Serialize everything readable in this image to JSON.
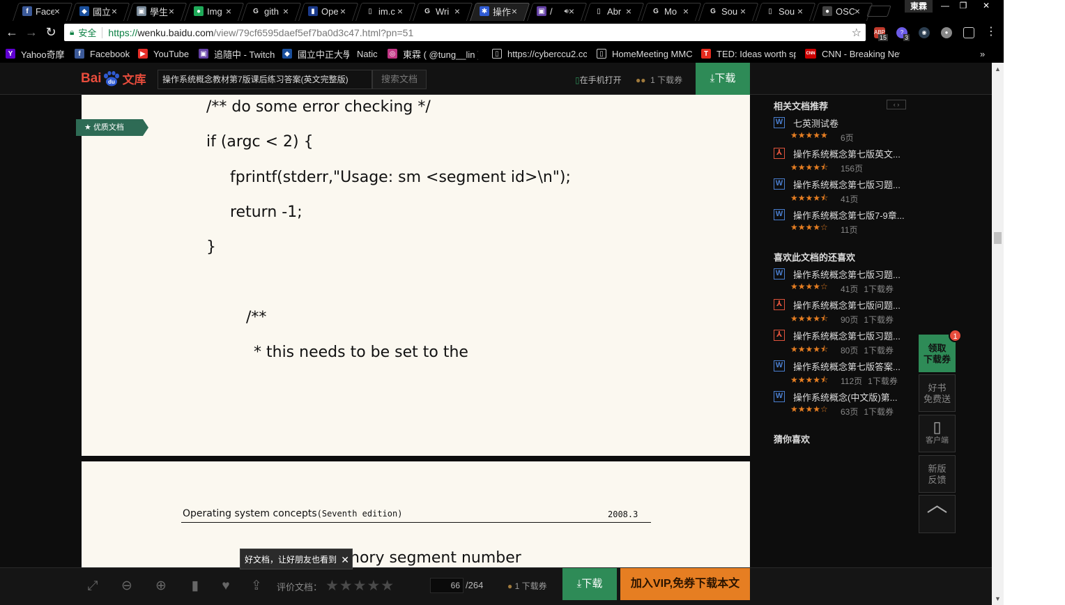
{
  "colors": {
    "accent_green": "#2e8b57",
    "vip_orange": "#e67e22",
    "star_orange": "#e67e22",
    "page_bg": "#fbf8f0",
    "badge_red": "#e74c3c"
  },
  "tabs": [
    {
      "title": "Face",
      "icon": "facebook-icon",
      "color": "#3b5998",
      "glyph": "f"
    },
    {
      "title": "國立",
      "icon": "school-icon",
      "color": "#1a4f9c",
      "glyph": "◆"
    },
    {
      "title": "學生",
      "icon": "image-icon",
      "color": "#7a8a99",
      "glyph": "▣"
    },
    {
      "title": "Img",
      "icon": "green-dot-icon",
      "color": "#1faa59",
      "glyph": "●"
    },
    {
      "title": "gith",
      "icon": "google-icon",
      "color": "#ffffff",
      "glyph": "G"
    },
    {
      "title": "Ope",
      "icon": "bookmark-icon",
      "color": "#1b3a8a",
      "glyph": "▮"
    },
    {
      "title": "im.c",
      "icon": "page-icon",
      "color": "#ffffff",
      "glyph": "▯"
    },
    {
      "title": "Wri",
      "icon": "google-icon",
      "color": "#ffffff",
      "glyph": "G"
    },
    {
      "title": "操作",
      "icon": "baidu-icon",
      "color": "#2f5bd3",
      "glyph": "✱",
      "active": true
    },
    {
      "title": "/",
      "icon": "twitch-icon",
      "color": "#6441a4",
      "glyph": "▣",
      "audio": true
    },
    {
      "title": "Abr",
      "icon": "page-icon",
      "color": "#ffffff",
      "glyph": "▯"
    },
    {
      "title": "Mo",
      "icon": "google-icon",
      "color": "#ffffff",
      "glyph": "G"
    },
    {
      "title": "Sou",
      "icon": "google-icon",
      "color": "#ffffff",
      "glyph": "G"
    },
    {
      "title": "Sou",
      "icon": "page-icon",
      "color": "#ffffff",
      "glyph": "▯"
    },
    {
      "title": "OSC",
      "icon": "github-icon",
      "color": "#444444",
      "glyph": "●"
    }
  ],
  "window": {
    "profile": "東霖",
    "minimize": "—",
    "restore": "❐",
    "close": "✕"
  },
  "toolbar": {
    "secure_label": "安全",
    "url_proto": "https://",
    "url_host": "wenku.baidu.com",
    "url_path": "/view/79cf6595daef5ef7ba0d3c47.html?pn=51",
    "ext_badges": [
      "15",
      "3"
    ]
  },
  "bookmarks": [
    {
      "label": "Yahoo奇摩",
      "icon": "yahoo-icon",
      "color": "#5f01d1",
      "glyph": "Y"
    },
    {
      "label": "Facebook",
      "icon": "facebook-icon",
      "color": "#3b5998",
      "glyph": "f"
    },
    {
      "label": "YouTube",
      "icon": "youtube-icon",
      "color": "#e52d27",
      "glyph": "▶"
    },
    {
      "label": "追隨中 - Twitch",
      "icon": "twitch-icon",
      "color": "#6441a4",
      "glyph": "▣"
    },
    {
      "label": "國立中正大學",
      "icon": "school-icon",
      "color": "#1a4f9c",
      "glyph": "◆"
    },
    {
      "label": "Natic",
      "icon": "blank-icon",
      "color": "#000000",
      "glyph": ""
    },
    {
      "label": "東霖 ( @tung__lin )",
      "icon": "instagram-icon",
      "color": "#c13584",
      "glyph": "◎"
    },
    {
      "label": "https://cyberccu2.cc",
      "icon": "page-icon",
      "color": "#000000",
      "glyph": "▯"
    },
    {
      "label": "HomeMeeting MMC",
      "icon": "page-icon",
      "color": "#000000",
      "glyph": "▯"
    },
    {
      "label": "TED: Ideas worth sp",
      "icon": "ted-icon",
      "color": "#e62b1e",
      "glyph": "T"
    },
    {
      "label": "CNN - Breaking New",
      "icon": "cnn-icon",
      "color": "#cc0000",
      "glyph": "CNN"
    }
  ],
  "bookmarks_overflow": "»",
  "baidu": {
    "logo_bai": "Bai",
    "logo_du": "du",
    "logo_wenku": "文库",
    "search_value": "操作系统概念教材第7版课后练习答案(英文完整版)",
    "search_button": "搜索文档",
    "open_on_phone": "在手机打开",
    "coupon_count": "1 下载券",
    "download": "下载"
  },
  "document": {
    "quality_badge": "优质文档",
    "page1_lines": [
      "/** do some error checking */",
      "if (argc < 2) {",
      "fprintf(stderr,\"Usage: sm <segment id>\\n\");",
      "return -1;",
      "}",
      "/**",
      "* this needs to be set to the"
    ],
    "page2_header_title": "Operating system concepts",
    "page2_header_edition": "(Seventh  edition)",
    "page2_header_date": "2008.3",
    "page2_line": "nory segment number",
    "share_tooltip": "好文档，让好朋友也看到",
    "tooltip_close": "✕"
  },
  "sidebar": {
    "related_title": "相关文档推荐",
    "related": [
      {
        "name": "七英测试卷",
        "type": "word",
        "stars": "★★★★★",
        "pages": "6页",
        "coupons": ""
      },
      {
        "name": "操作系统概念第七版英文...",
        "type": "pdf",
        "stars": "★★★★⯪",
        "pages": "156页",
        "coupons": ""
      },
      {
        "name": "操作系统概念第七版习题...",
        "type": "word",
        "stars": "★★★★⯪",
        "pages": "41页",
        "coupons": ""
      },
      {
        "name": "操作系统概念第七版7-9章...",
        "type": "word",
        "stars": "★★★★☆",
        "pages": "11页",
        "coupons": ""
      }
    ],
    "liked_title": "喜欢此文档的还喜欢",
    "liked": [
      {
        "name": "操作系统概念第七版习题...",
        "type": "word",
        "stars": "★★★★☆",
        "pages": "41页",
        "coupons": "1下载券"
      },
      {
        "name": "操作系统概念第七版问题...",
        "type": "pdf",
        "stars": "★★★★⯪",
        "pages": "90页",
        "coupons": "1下载券"
      },
      {
        "name": "操作系统概念第七版习题...",
        "type": "pdf",
        "stars": "★★★★⯪",
        "pages": "80页",
        "coupons": "1下载券"
      },
      {
        "name": "操作系统概念第七版答案...",
        "type": "word",
        "stars": "★★★★⯪",
        "pages": "112页",
        "coupons": "1下载券"
      },
      {
        "name": "操作系统概念(中文版)第...",
        "type": "word",
        "stars": "★★★★☆",
        "pages": "63页",
        "coupons": "1下载券"
      }
    ],
    "guess_title": "猜你喜欢"
  },
  "float_buttons": {
    "coupon_line1": "领取",
    "coupon_line2": "下载券",
    "coupon_badge": "1",
    "book_line1": "好书",
    "book_line2": "免费送",
    "client_label": "客户端",
    "feedback_line1": "新版",
    "feedback_line2": "反馈",
    "top_glyph": "︿"
  },
  "bottom_bar": {
    "rate_label": "评价文档：",
    "rate_stars": "★★★★★",
    "page_current": "66",
    "page_total": "/264",
    "coupon": "1 下载券",
    "download": "下载",
    "vip": "加入VIP,免券下载本文"
  }
}
